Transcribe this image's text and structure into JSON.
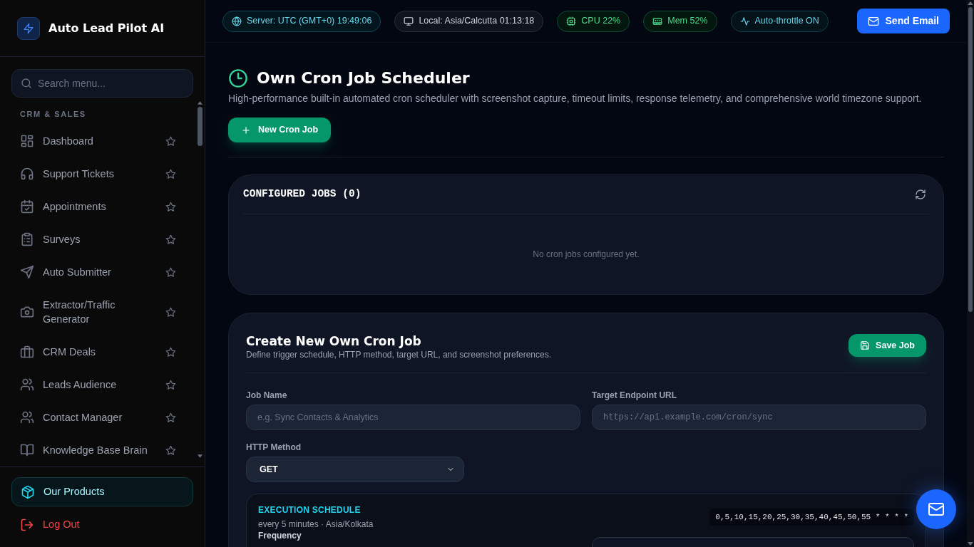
{
  "sidebar": {
    "brand": "Auto Lead Pilot AI",
    "search": {
      "placeholder": "Search menu..."
    },
    "sections": [
      {
        "heading": "CRM & SALES",
        "items": [
          {
            "label": "Dashboard",
            "favorite": false
          },
          {
            "label": "Support Tickets",
            "favorite": false
          },
          {
            "label": "Appointments",
            "favorite": false
          },
          {
            "label": "Surveys",
            "favorite": false
          },
          {
            "label": "Auto Submitter",
            "favorite": false
          },
          {
            "label": "Extractor/Traffic Generator",
            "favorite": false
          },
          {
            "label": "CRM Deals",
            "favorite": false
          },
          {
            "label": "Leads Audience",
            "favorite": false
          },
          {
            "label": "Contact Manager",
            "favorite": false
          },
          {
            "label": "Knowledge Base Brain",
            "favorite": false
          }
        ]
      }
    ],
    "footer": [
      {
        "label": "Our Products",
        "kind": "highlight"
      },
      {
        "label": "Log Out",
        "kind": "danger"
      }
    ]
  },
  "status_bar": {
    "pills": [
      {
        "label": "Server: UTC (GMT+0) 19:49:06",
        "kind": "server"
      },
      {
        "label": "Local: Asia/Calcutta 01:13:18",
        "kind": "local"
      },
      {
        "label": "CPU 22%",
        "kind": "cpu"
      },
      {
        "label": "Mem 52%",
        "kind": "memory"
      },
      {
        "label": "Auto-throttle ON",
        "kind": "throttle"
      }
    ],
    "action": "Send Email"
  },
  "page": {
    "title": "Own Cron Job Scheduler",
    "description": "High-performance built-in automated cron scheduler with screenshot capture, timeout limits, response telemetry, and comprehensive world timezone support.",
    "new_button": "New Cron Job"
  },
  "jobs_panel": {
    "title": "CONFIGURED JOBS (0)",
    "empty_message": "No cron jobs configured yet."
  },
  "create_form": {
    "title": "Create New Own Cron Job",
    "subtitle": "Define trigger schedule, HTTP method, target URL, and screenshot preferences.",
    "save_button": "Save Job",
    "fields": [
      {
        "label": "Job Name",
        "kind": "text",
        "placeholder": "e.g. Sync Contacts & Analytics"
      },
      {
        "label": "Target Endpoint URL",
        "kind": "url",
        "placeholder": "https://api.example.com/cron/sync"
      },
      {
        "label": "HTTP Method",
        "kind": "select",
        "value": "GET"
      }
    ],
    "schedule": {
      "title": "EXECUTION SCHEDULE",
      "summary": "every 5 minutes · Asia/Kolkata",
      "expression": "0,5,10,15,20,25,30,35,40,45,50,55 * * * *",
      "fields": [
        {
          "label": "Frequency"
        }
      ]
    }
  }
}
